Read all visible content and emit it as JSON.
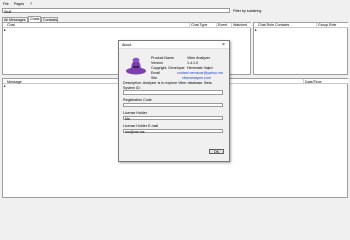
{
  "menu": {
    "file": "File",
    "pages": "Pages",
    "help": "?"
  },
  "filter": {
    "value": "Stuff",
    "label": "Filter by substring"
  },
  "tabs": [
    {
      "label": "All Messages"
    },
    {
      "label": "Chats"
    },
    {
      "label": "Contacts"
    }
  ],
  "chats_table": {
    "columns": [
      "Chat",
      "Chat Type",
      "Event",
      "Watched"
    ],
    "row_marker": "▸"
  },
  "contacts_table": {
    "columns": [
      "Chat Role Contacts",
      "Group Role"
    ],
    "row_marker": "▸"
  },
  "messages_table": {
    "columns": [
      "Message",
      "Date/Time"
    ],
    "row_marker": "▸"
  },
  "about": {
    "title": "About",
    "close_glyph": "×",
    "info": [
      {
        "label": "Product Name",
        "value": "Viber Analyzer",
        "link": false
      },
      {
        "label": "Version",
        "value": "1.4.1.0",
        "link": false
      },
      {
        "label": "Copyright, Developer",
        "value": "Hemmate Vajed",
        "link": false
      },
      {
        "label": "Email",
        "value": "contact.nemsoar@yahoo.me",
        "link": true
      },
      {
        "label": "Site",
        "value": "viberanalyzer.com",
        "link": true
      }
    ],
    "description": "Description: Analyzer is to explore Viber database. Beta",
    "system_id_label": "System ID:",
    "system_id_value": "",
    "registration_code_label": "Registration Code",
    "registration_code_value": "",
    "license_holder_label": "License Holder",
    "license_holder_value": "Me",
    "license_email_label": "License Holder E-mail",
    "license_email_value": "me@me.me",
    "ok_label": "OK",
    "logo_color": "#7b3fb0"
  }
}
